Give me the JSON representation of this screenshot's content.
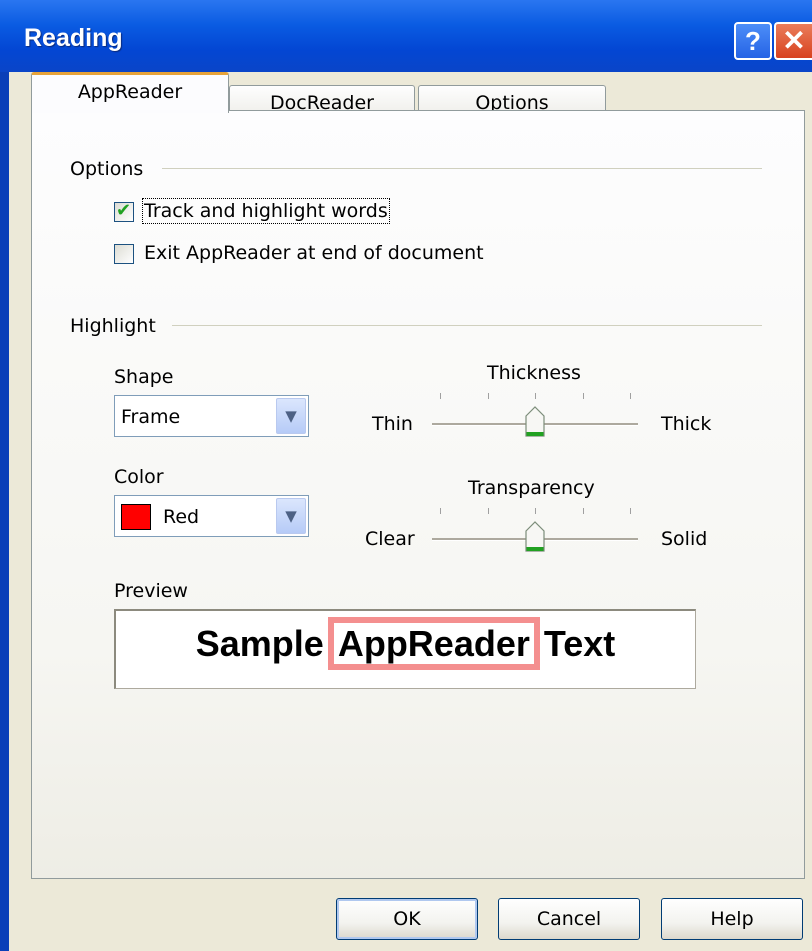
{
  "window": {
    "title": "Reading",
    "help_glyph": "?",
    "close_glyph": "✕"
  },
  "tabs": [
    {
      "label": "AppReader",
      "selected": true
    },
    {
      "label": "DocReader",
      "selected": false
    },
    {
      "label": "Options",
      "selected": false
    }
  ],
  "options_group": {
    "label": "Options",
    "track_highlight": {
      "label": "Track and highlight words",
      "checked": true
    },
    "exit_at_end": {
      "label": "Exit AppReader at end of document",
      "checked": false
    }
  },
  "highlight_group": {
    "label": "Highlight",
    "shape": {
      "label": "Shape",
      "value": "Frame"
    },
    "color": {
      "label": "Color",
      "value": "Red",
      "swatch": "#ff0000"
    },
    "thickness": {
      "label": "Thickness",
      "min_label": "Thin",
      "max_label": "Thick",
      "level": 0.5
    },
    "transparency": {
      "label": "Transparency",
      "min_label": "Clear",
      "max_label": "Solid",
      "level": 0.5
    }
  },
  "preview": {
    "label": "Preview",
    "before": "Sample",
    "highlighted": "AppReader",
    "after": "Text",
    "highlight_color": "#f48f8f"
  },
  "buttons": {
    "ok": "OK",
    "cancel": "Cancel",
    "help": "Help"
  }
}
